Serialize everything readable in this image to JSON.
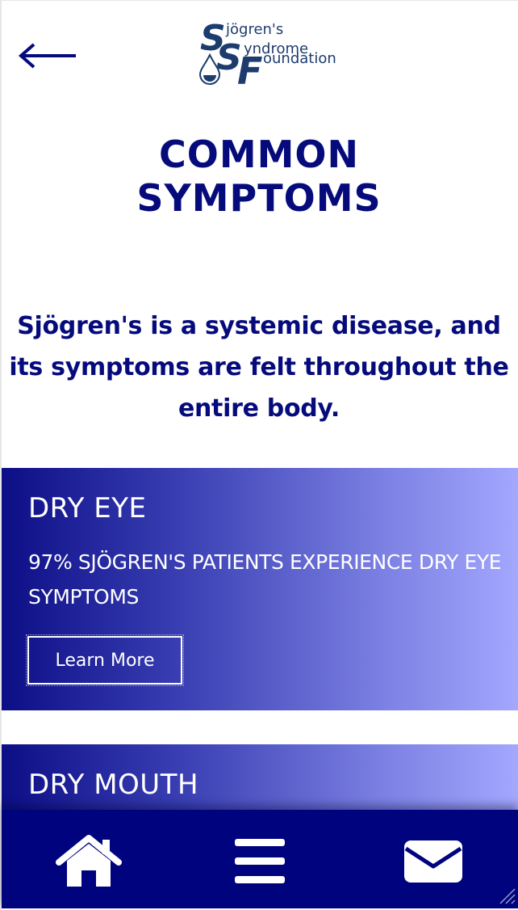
{
  "header": {
    "back_icon": "arrow-left-icon",
    "logo": {
      "line1": "Sjögren's",
      "line2": "Syndrome",
      "line3": "Foundation",
      "big_letters": "SSF",
      "icon": "water-drop-icon"
    }
  },
  "page": {
    "title_line1": "COMMON",
    "title_line2": "SYMPTOMS",
    "intro": "Sjögren's is a systemic disease, and its symptoms are felt throughout the entire body."
  },
  "cards": [
    {
      "title": "DRY EYE",
      "description": "97% SJÖGREN'S PATIENTS EXPERIENCE DRY EYE SYMPTOMS",
      "button_label": "Learn More"
    },
    {
      "title": "DRY MOUTH"
    }
  ],
  "bottom_nav": {
    "items": [
      {
        "icon": "home-icon"
      },
      {
        "icon": "menu-icon"
      },
      {
        "icon": "mail-icon"
      }
    ]
  },
  "colors": {
    "brand_navy": "#060b7c",
    "nav_background": "#00037e",
    "gradient_start": "#0c0e86",
    "gradient_end": "#a3a7fd",
    "logo_blue": "#1d3c6e"
  }
}
